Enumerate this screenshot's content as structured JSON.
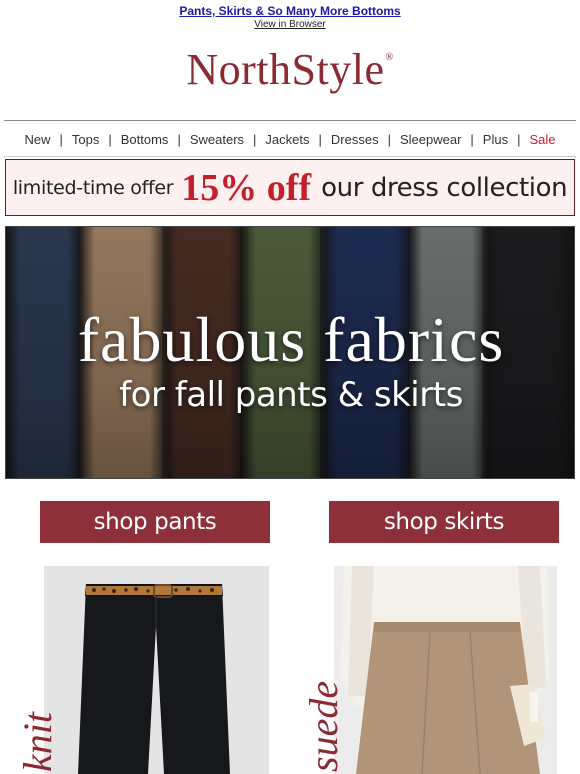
{
  "preheader": {
    "headline": "Pants, Skirts & So Many More Bottoms",
    "browser_link": "View in Browser"
  },
  "brand": {
    "name": "NorthStyle",
    "mark": "®",
    "color": "#8c2a33"
  },
  "nav": {
    "items": [
      "New",
      "Tops",
      "Bottoms",
      "Sweaters",
      "Jackets",
      "Dresses",
      "Sleepwear",
      "Plus",
      "Sale"
    ],
    "separator": "|",
    "sale_color": "#c4232e"
  },
  "offer": {
    "lead": "limited-time offer",
    "discount": "15% off",
    "tail": "our dress collection",
    "accent_color": "#c41f2b"
  },
  "hero": {
    "title": "fabulous fabrics",
    "subtitle": "for fall pants & skirts",
    "swatch_colors": [
      "#2d3a52",
      "#9c7d62",
      "#4a2e24",
      "#4f5f3c",
      "#1f2d55",
      "#6e7371",
      "#1d1d20"
    ]
  },
  "shop_buttons": {
    "pants": "shop pants",
    "skirts": "shop skirts",
    "color": "#8e3039"
  },
  "products": {
    "left_word": "knit",
    "right_word": "suede"
  }
}
